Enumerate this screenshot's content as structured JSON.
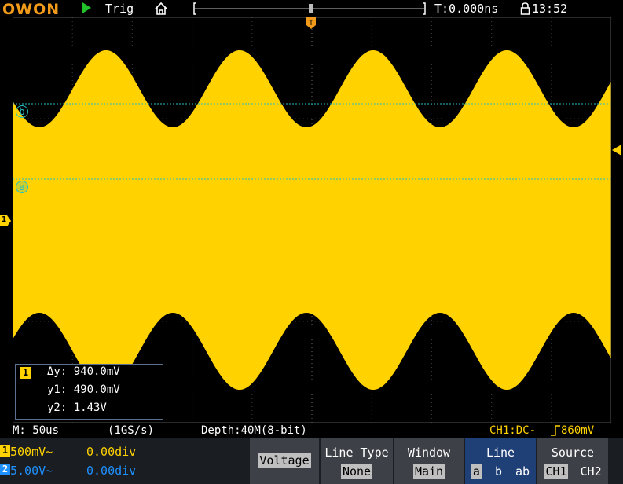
{
  "topbar": {
    "brand": "OWON",
    "trig_label": "Trig",
    "trigger_time": "T:0.000ns",
    "clock": "13:52",
    "trigger_marker": "T"
  },
  "markers": {
    "cursor_b": "b",
    "cursor_a": "a",
    "ch1_marker": "1"
  },
  "cursor_box": {
    "channel": "1",
    "dy": "Δy: 940.0mV",
    "y1": "y1: 490.0mV",
    "y2": "y2: 1.43V"
  },
  "status": {
    "timebase": "M: 50us",
    "sample_rate": "(1GS/s)",
    "depth": "Depth:40M(8-bit)",
    "trigger_info": "CH1:DC-",
    "trigger_level": "860mV"
  },
  "channels": [
    {
      "id": "1",
      "scale": "500mV~",
      "offset": "0.00div",
      "color": "#ffd200"
    },
    {
      "id": "2",
      "scale": "5.00V~",
      "offset": "0.00div",
      "color": "#1e90ff"
    }
  ],
  "menu": {
    "voltage": "Voltage",
    "line_type": {
      "label": "Line Type",
      "value": "None"
    },
    "window": {
      "label": "Window",
      "value": "Main"
    },
    "line": {
      "label": "Line",
      "opt_a": "a",
      "opt_b": "b",
      "opt_ab": "ab"
    },
    "source": {
      "label": "Source",
      "opt_ch1": "CH1",
      "opt_ch2": "CH2"
    }
  },
  "colors": {
    "ch1": "#ffd200",
    "ch2": "#1e90ff",
    "cursor": "#27c0c0",
    "brand": "#f29a1a",
    "run": "#22c22a",
    "trigger_marker": "#f29a1a"
  }
}
